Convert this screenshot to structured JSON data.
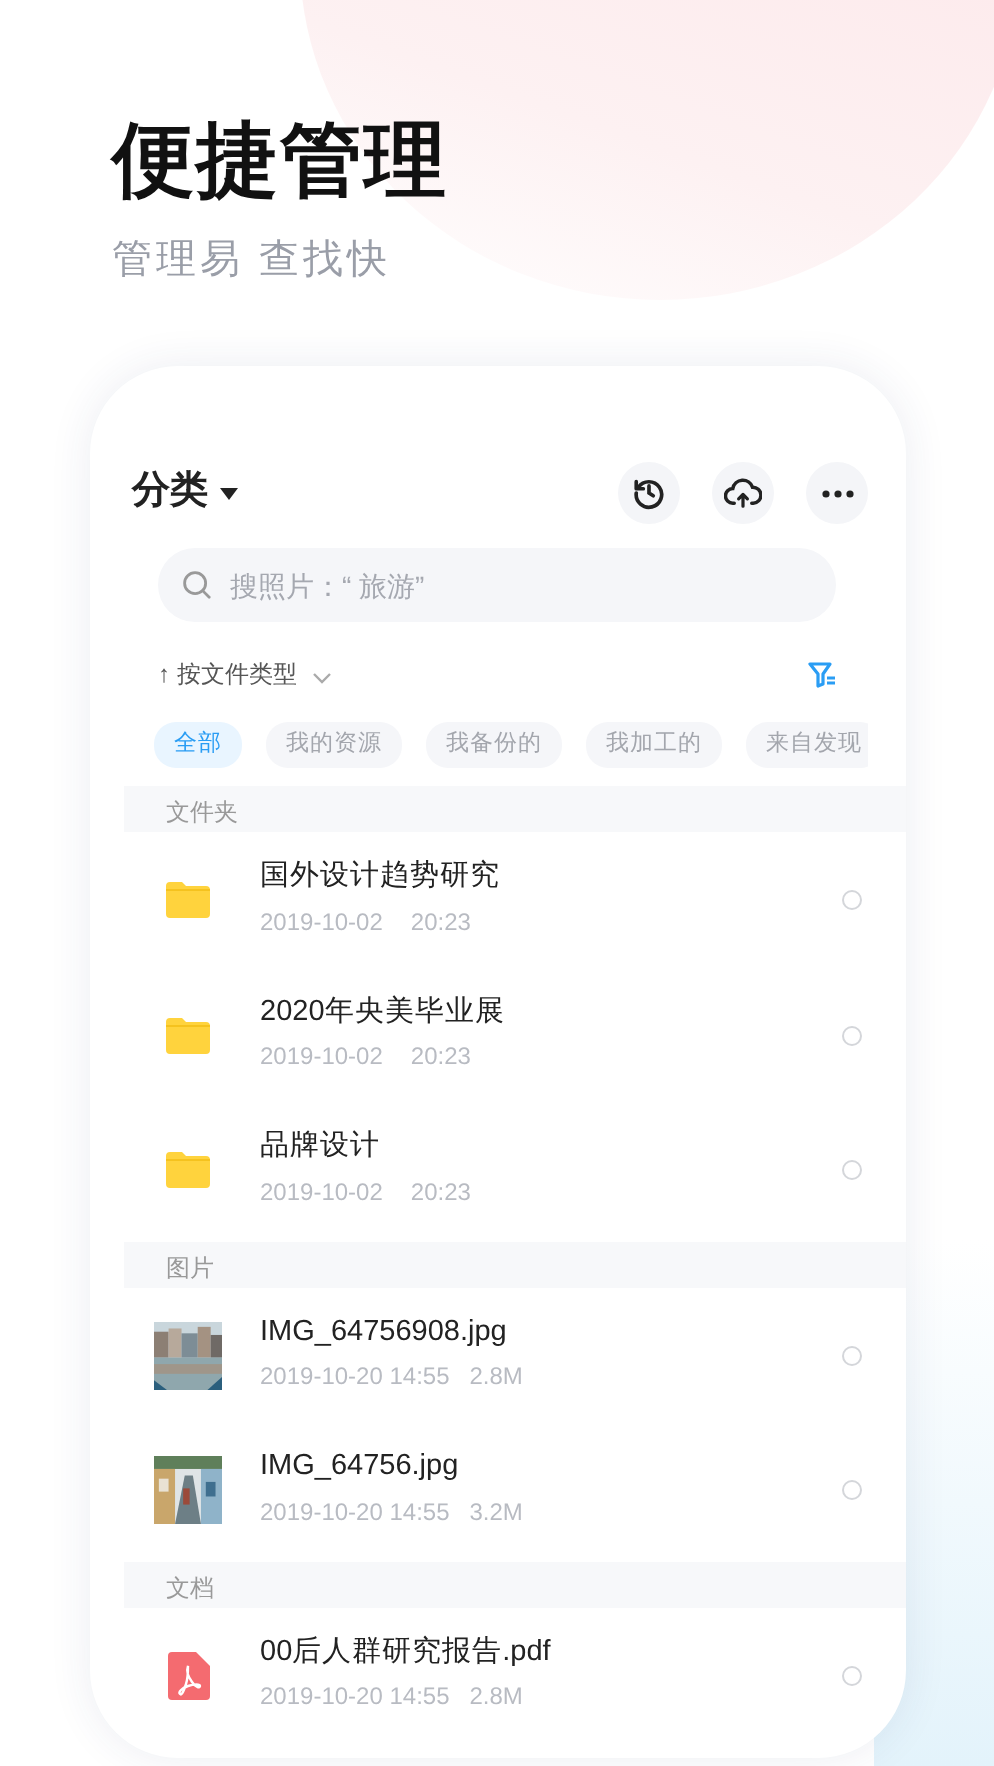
{
  "screen": {
    "title": "便捷管理",
    "subtitle": "管理易 查找快"
  },
  "app": {
    "category_menu": "分类",
    "search": {
      "placeholder": "搜照片：“ 旅游”"
    },
    "sort_label": "↑ 按文件类型",
    "filters": [
      {
        "label": "全部",
        "selected": true
      },
      {
        "label": "我的资源",
        "selected": false
      },
      {
        "label": "我备份的",
        "selected": false
      },
      {
        "label": "我加工的",
        "selected": false
      },
      {
        "label": "来自发现",
        "selected": false
      }
    ],
    "sections": [
      {
        "title": "文件夹",
        "items": [
          {
            "kind": "folder",
            "name": "国外设计趋势研究",
            "meta": [
              "2019-10-02",
              "20:23"
            ],
            "selected": false
          },
          {
            "kind": "folder",
            "name": "2020年央美毕业展",
            "meta": [
              "2019-10-02",
              "20:23"
            ],
            "selected": false
          },
          {
            "kind": "folder",
            "name": "品牌设计",
            "meta": [
              "2019-10-02",
              "20:23"
            ],
            "selected": false
          }
        ]
      },
      {
        "title": "图片",
        "items": [
          {
            "name": "IMG_64756908.jpg",
            "meta": [
              "2019-10-20 14:55",
              "2.8M"
            ],
            "selected": false
          },
          {
            "name": "IMG_64756.jpg",
            "meta": [
              "2019-10-20 14:55",
              "3.2M"
            ],
            "selected": false
          }
        ]
      },
      {
        "title": "文档",
        "items": [
          {
            "kind": "pdf",
            "name": "00后人群研究报告.pdf",
            "meta": [
              "2019-10-20 14:55",
              "2.8M"
            ],
            "selected": false
          }
        ]
      }
    ]
  }
}
